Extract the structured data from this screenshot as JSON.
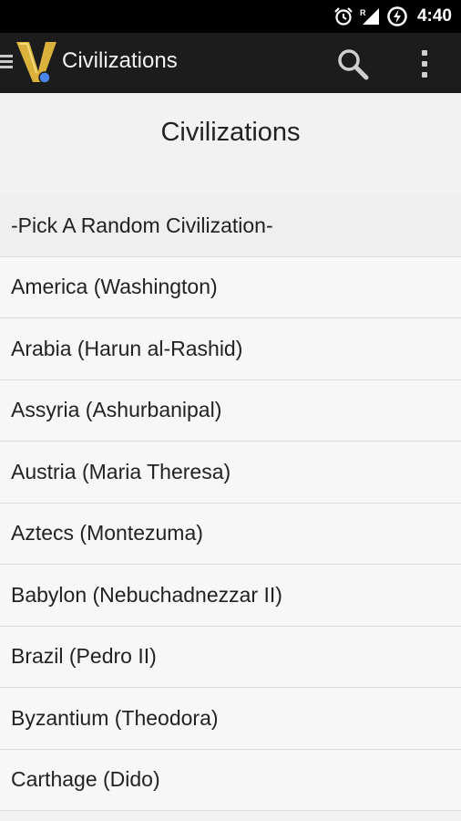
{
  "status_bar": {
    "time": "4:40",
    "roaming_label": "R",
    "icons": [
      "alarm-icon",
      "signal-icon",
      "battery-charging-icon"
    ]
  },
  "action_bar": {
    "title": "Civilizations",
    "icons": [
      "menu-icon",
      "app-logo-icon",
      "search-icon",
      "overflow-menu-icon"
    ],
    "colors": {
      "background": "#1c1c1c",
      "logo_gold": "#d9b13b",
      "logo_blue": "#4a86e8"
    }
  },
  "page": {
    "heading": "Civilizations"
  },
  "civilizations": [
    "-Pick A Random Civilization-",
    "America (Washington)",
    "Arabia (Harun al-Rashid)",
    "Assyria (Ashurbanipal)",
    "Austria (Maria Theresa)",
    "Aztecs (Montezuma)",
    "Babylon (Nebuchadnezzar II)",
    "Brazil (Pedro II)",
    "Byzantium (Theodora)",
    "Carthage (Dido)"
  ]
}
